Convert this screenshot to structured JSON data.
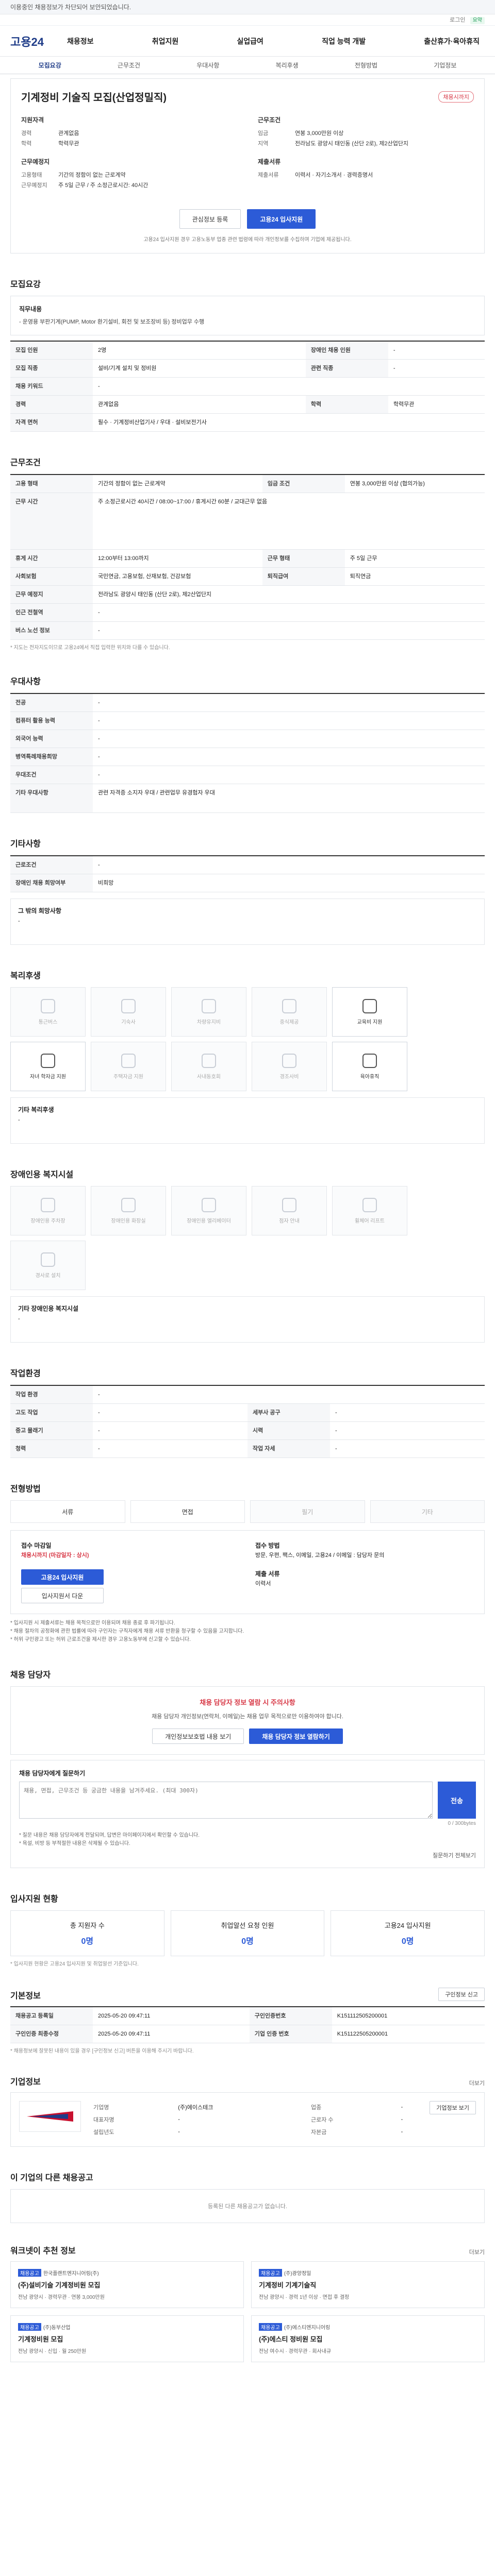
{
  "topbar": {
    "text": "이용중인 채용정보가 차단되어 보안되었습니다."
  },
  "topbar2": {
    "link": "로그인",
    "badge": "요약"
  },
  "gnb": {
    "logo": "고용24",
    "menu": [
      "채용정보",
      "취업지원",
      "실업급여",
      "직업 능력 개발",
      "출산휴가·육아휴직"
    ]
  },
  "tabs": [
    "모집요강",
    "근무조건",
    "우대사항",
    "복리후생",
    "전형방법",
    "기업정보"
  ],
  "job": {
    "title": "기계정비 기술직 모집(산업정밀직)",
    "status": "채용시까지",
    "left_heading": "지원자격",
    "left_items": [
      {
        "k": "경력",
        "v": "관계없음"
      },
      {
        "k": "학력",
        "v": "학력무관"
      }
    ],
    "left_heading2": "근무예정지",
    "left_items2": [
      {
        "k": "고용형태",
        "v": "기간의 정함이 없는 근로계약"
      },
      {
        "k": "근무예정지",
        "v": "주 5일 근무 / 주 소정근로시간: 40시간"
      }
    ],
    "right_heading": "근무조건",
    "right_items": [
      {
        "k": "임금",
        "v": "연봉 3,000만원 이상"
      },
      {
        "k": "지역",
        "v": "전라남도 광양시 태인동 (산단 2로), 제2산업단지"
      }
    ],
    "right_heading2": "제출서류",
    "right_items2": [
      {
        "k": "제출서류",
        "v": "이력서 · 자기소개서 · 경력증명서"
      }
    ],
    "btn_interest": "관심정보 등록",
    "btn_apply": "고용24 입사지원",
    "notice": "고용24 입사지원 경우 고용노동부 업종 관련 법령에 따라 개인정보를 수집하며 기업에 제공됩니다."
  },
  "recruit": {
    "title": "모집요강",
    "box_heading": "직무내용",
    "box_text": "- 운영용 부판기계(PUMP, Motor 환기설비, 회전 및 보조장비 등) 정비업무 수행",
    "rows": [
      {
        "k": "모집 인원",
        "v": "2명",
        "k2": "장애인 채용 인원",
        "v2": "-"
      },
      {
        "k": "모집 직종",
        "v": "설비/기계 설치 및 정비원",
        "k2": "관련 직종",
        "v2": "-"
      },
      {
        "k": "채용 키워드",
        "v": "-",
        "k2": "",
        "v2": ""
      },
      {
        "k": "경력",
        "v": "관계없음",
        "k2": "학력",
        "v2": "학력무관"
      },
      {
        "k": "자격 면허",
        "v": "필수 · 기계정비산업기사 / 우대 · 설비보전기사",
        "k2": "",
        "v2": ""
      }
    ]
  },
  "conditions": {
    "title": "근무조건",
    "rows": [
      {
        "k": "고용 형태",
        "v": "기간의 정함이 없는 근로계약",
        "k2": "임금 조건",
        "v2": "연봉 3,000만원 이상 (협의가능)"
      },
      {
        "k": "근무 시간",
        "v": "주 소정근로시간 40시간 / 08:00~17:00 / 휴게시간 60분 / 교대근무 없음",
        "k2": "",
        "v2": ""
      },
      {
        "k": "휴게 시간",
        "v": "12:00부터 13:00까지",
        "k2": "근무 형태",
        "v2": "주 5일 근무"
      },
      {
        "k": "사회보험",
        "v": "국민연금, 고용보험, 산재보험, 건강보험",
        "k2": "퇴직급여",
        "v2": "퇴직연금"
      },
      {
        "k": "근무 예정지",
        "v": "전라남도 광양시 태인동 (산단 2로), 제2산업단지",
        "k2": "",
        "v2": ""
      },
      {
        "k": "인근 전철역",
        "v": "-",
        "k2": "",
        "v2": ""
      },
      {
        "k": "버스 노선 정보",
        "v": "-",
        "k2": "",
        "v2": ""
      }
    ],
    "note": "* 지도는 전자지도이므로 고용24에서 직접 입력한 위치와 다를 수 있습니다."
  },
  "prefer": {
    "title": "우대사항",
    "rows": [
      {
        "k": "전공",
        "v": "-"
      },
      {
        "k": "컴퓨터 활용 능력",
        "v": "-"
      },
      {
        "k": "외국어 능력",
        "v": "-"
      },
      {
        "k": "병역특례채용희망",
        "v": "-"
      },
      {
        "k": "우대조건",
        "v": "-"
      },
      {
        "k": "기타 우대사항",
        "v": "관련 자격증 소지자 우대 / 관련업무 유경험자 우대"
      }
    ]
  },
  "etc": {
    "title": "기타사항",
    "rows": [
      {
        "k": "근로조건",
        "v": "-"
      },
      {
        "k": "장애인 채용 희망여부",
        "v": "비희망"
      }
    ],
    "sub_title": "그 밖의 희망사항",
    "sub_text": "-"
  },
  "welfare": {
    "title": "복리후생",
    "items": [
      {
        "label": "통근버스",
        "on": false
      },
      {
        "label": "기숙사",
        "on": false
      },
      {
        "label": "차량유지비",
        "on": false
      },
      {
        "label": "중식제공",
        "on": false
      },
      {
        "label": "교육비 지원",
        "on": true
      },
      {
        "label": "자녀 학자금 지원",
        "on": true
      },
      {
        "label": "주택자금 지원",
        "on": false
      },
      {
        "label": "사내동호회",
        "on": false
      },
      {
        "label": "경조사비",
        "on": false
      },
      {
        "label": "육아휴직",
        "on": true
      }
    ],
    "sub_title": "기타 복리후생",
    "sub_text": "-"
  },
  "disabled": {
    "title": "장애인용 복지시설",
    "items": [
      {
        "label": "장애인용 주차장",
        "on": false
      },
      {
        "label": "장애인용 화장실",
        "on": false
      },
      {
        "label": "장애인용 엘리베이터",
        "on": false
      },
      {
        "label": "점자 안내",
        "on": false
      },
      {
        "label": "휠체어 리프트",
        "on": false
      },
      {
        "label": "경사로 설치",
        "on": false
      }
    ],
    "sub_title": "기타 장애인용 복지시설",
    "sub_text": "-"
  },
  "workenv": {
    "title": "작업환경",
    "rows": [
      {
        "k": "작업 환경",
        "v": "-",
        "k2": "",
        "v2": ""
      },
      {
        "k": "고도 작업",
        "v": "-",
        "k2": "세부사 공구",
        "v2": "-"
      },
      {
        "k": "중고 물래기",
        "v": "-",
        "k2": "시력",
        "v2": "-"
      },
      {
        "k": "청력",
        "v": "-",
        "k2": "작업 자세",
        "v2": "-"
      }
    ]
  },
  "method": {
    "title": "전형방법",
    "items": [
      {
        "label": "서류",
        "on": true
      },
      {
        "label": "면접",
        "on": true
      },
      {
        "label": "필기",
        "on": false
      },
      {
        "label": "기타",
        "on": false
      }
    ],
    "apply_title": "접수 마감일",
    "apply_period": "채용시까지 (마감일자 : 상시)",
    "apply_btn": "고용24 입사지원",
    "apply_btn2": "입사지원서 다운",
    "right_title": "접수 방법",
    "right_text": "방문, 우편, 팩스, 이메일, 고용24 / 이메일 : 담당자 문의",
    "right_title2": "제출 서류",
    "right_text2": "이력서",
    "bullets": [
      "* 입사지원 시 제출서류는 채용 목적으로만 이용되며 채용 종료 후 파기됩니다.",
      "* 채용 절차의 공정화에 관한 법률에 따라 구인자는 구직자에게 채용 서류 반환을 청구할 수 있음을 고지합니다.",
      "* 허위 구인광고 또는 허위 근로조건을 제시한 경우 고용노동부에 신고할 수 있습니다."
    ]
  },
  "manager": {
    "title": "채용 담당자",
    "warn": "채용 담당자 정보 열람 시 주의사항",
    "desc": "채용 담당자 개인정보(연락처, 이메일)는 채용 업무 목적으로만 이용하여야 합니다.",
    "btn1": "개인정보보호법 내용 보기",
    "btn2": "채용 담당자 정보 열람하기"
  },
  "qa": {
    "title": "채용 담당자에게 질문하기",
    "placeholder": "채용, 면접, 근무조건 등 궁금한 내용을 남겨주세요. (최대 300자)",
    "count": "0 / 300bytes",
    "send": "전송",
    "notes": [
      "* 질문 내용은 채용 담당자에게 전달되며, 답변은 마이페이지에서 확인할 수 있습니다.",
      "* 욕설, 비방 등 부적절한 내용은 삭제될 수 있습니다."
    ],
    "link": "질문하기 전체보기"
  },
  "status": {
    "title": "입사지원 현황",
    "items": [
      {
        "label": "총 지원자 수",
        "n": "0명"
      },
      {
        "label": "취업알선 요청 인원",
        "n": "0명"
      },
      {
        "label": "고용24 입사지원",
        "n": "0명"
      }
    ],
    "note": "* 입사지원 현황은 고용24 입사지원 및 취업알선 기준입니다."
  },
  "basic": {
    "title": "기본정보",
    "btn": "구인정보 신고",
    "rows": [
      {
        "k": "채용공고 등록일",
        "v": "2025-05-20 09:47:11",
        "k2": "구인인증번호",
        "v2": "K151112505200001"
      },
      {
        "k": "구인인증 최종수정",
        "v": "2025-05-20 09:47:11",
        "k2": "기업 인증 번호",
        "v2": "K151122505200001"
      }
    ],
    "note": "* 채용정보에 잘못된 내용이 있을 경우 [구인정보 신고] 버튼을 이용해 주시기 바랍니다."
  },
  "company": {
    "title": "기업정보",
    "more": "더보기",
    "rows": [
      {
        "k": "기업명",
        "v": "(주)에이스테크",
        "k2": "업종",
        "v2": "-"
      },
      {
        "k": "대표자명",
        "v": "-",
        "k2": "근로자 수",
        "v2": "-"
      },
      {
        "k": "설립년도",
        "v": "-",
        "k2": "자본금",
        "v2": "-"
      }
    ],
    "btn": "기업정보 보기"
  },
  "other_jobs": {
    "title": "이 기업의 다른 채용공고",
    "empty": "등록된 다른 채용공고가 없습니다."
  },
  "recommend": {
    "title": "워크넷이 추천 정보",
    "more": "더보기",
    "cards": [
      {
        "tag": "채용공고",
        "company": "한국플랜트엔지니어링(주)",
        "title": "(주)설비기술 기계정비원 모집",
        "sub": "전남 광양시 · 경력무관 · 연봉 3,000만원"
      },
      {
        "tag": "채용공고",
        "company": "(주)광양정밀",
        "title": "기계정비 기계기술직",
        "sub": "전남 광양시 · 경력 1년 이상 · 면접 후 결정"
      },
      {
        "tag": "채용공고",
        "company": "(주)동부산업",
        "title": "기계정비원 모집",
        "sub": "전남 광양시 · 신입 · 월 250만원"
      },
      {
        "tag": "채용공고",
        "company": "(주)에스티엔지니어링",
        "title": "(주)에스티 정비원 모집",
        "sub": "전남 여수시 · 경력무관 · 회사내규"
      }
    ]
  }
}
